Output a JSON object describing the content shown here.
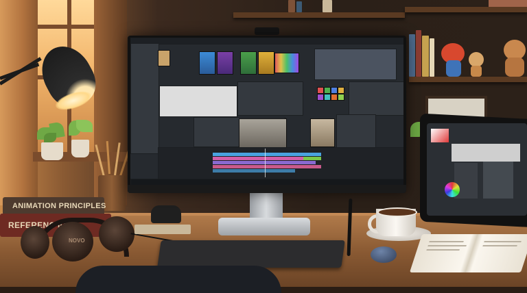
{
  "scene": "Animator desk workspace with monitor showing video editing software",
  "books": {
    "top_title": "ANIMATION PRINCIPLES",
    "bottom_title": "REFERENC  ICO"
  },
  "headphones_brand": "NOVO",
  "colors": {
    "window_glow": "#f2b46a",
    "desk_wood": "#8a5a33",
    "screen_bg": "#262a2f",
    "timeline_blue": "#4aa3e0",
    "timeline_pink": "#d35fa8",
    "timeline_green": "#7bc94a"
  }
}
